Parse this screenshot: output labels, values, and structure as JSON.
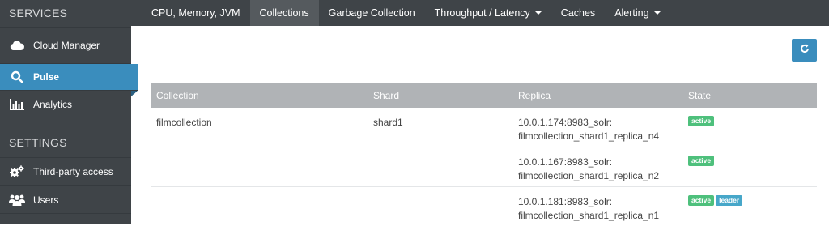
{
  "sidebar": {
    "services_heading": "SERVICES",
    "items": [
      {
        "label": "Cloud Manager",
        "icon": "cloud-icon"
      },
      {
        "label": "Pulse",
        "icon": "search-icon"
      },
      {
        "label": "Analytics",
        "icon": "bar-chart-icon"
      }
    ],
    "settings_heading": "SETTINGS",
    "settings_items": [
      {
        "label": "Third-party access",
        "icon": "gears-icon"
      },
      {
        "label": "Users",
        "icon": "users-icon"
      }
    ]
  },
  "topnav": {
    "tabs": [
      {
        "label": "CPU, Memory, JVM"
      },
      {
        "label": "Collections"
      },
      {
        "label": "Garbage Collection"
      },
      {
        "label": "Throughput / Latency"
      },
      {
        "label": "Caches"
      },
      {
        "label": "Alerting"
      }
    ]
  },
  "refresh_button": {
    "icon": "refresh-icon"
  },
  "table": {
    "headers": [
      "Collection",
      "Shard",
      "Replica",
      "State"
    ],
    "rows": [
      {
        "collection": "filmcollection",
        "shard": "shard1",
        "replica_host": "10.0.1.174:8983_solr:",
        "replica_name": "filmcollection_shard1_replica_n4",
        "state": [
          "active"
        ]
      },
      {
        "collection": "",
        "shard": "",
        "replica_host": "10.0.1.167:8983_solr:",
        "replica_name": "filmcollection_shard1_replica_n2",
        "state": [
          "active"
        ]
      },
      {
        "collection": "",
        "shard": "",
        "replica_host": "10.0.1.181:8983_solr:",
        "replica_name": "filmcollection_shard1_replica_n1",
        "state": [
          "active",
          "leader"
        ]
      }
    ]
  },
  "colors": {
    "sidebar_bg": "#3f4448",
    "accent": "#3a8dbd",
    "active_badge": "#4ec07c",
    "leader_badge": "#47a7c9",
    "table_header_bg": "#b0b3b6"
  }
}
